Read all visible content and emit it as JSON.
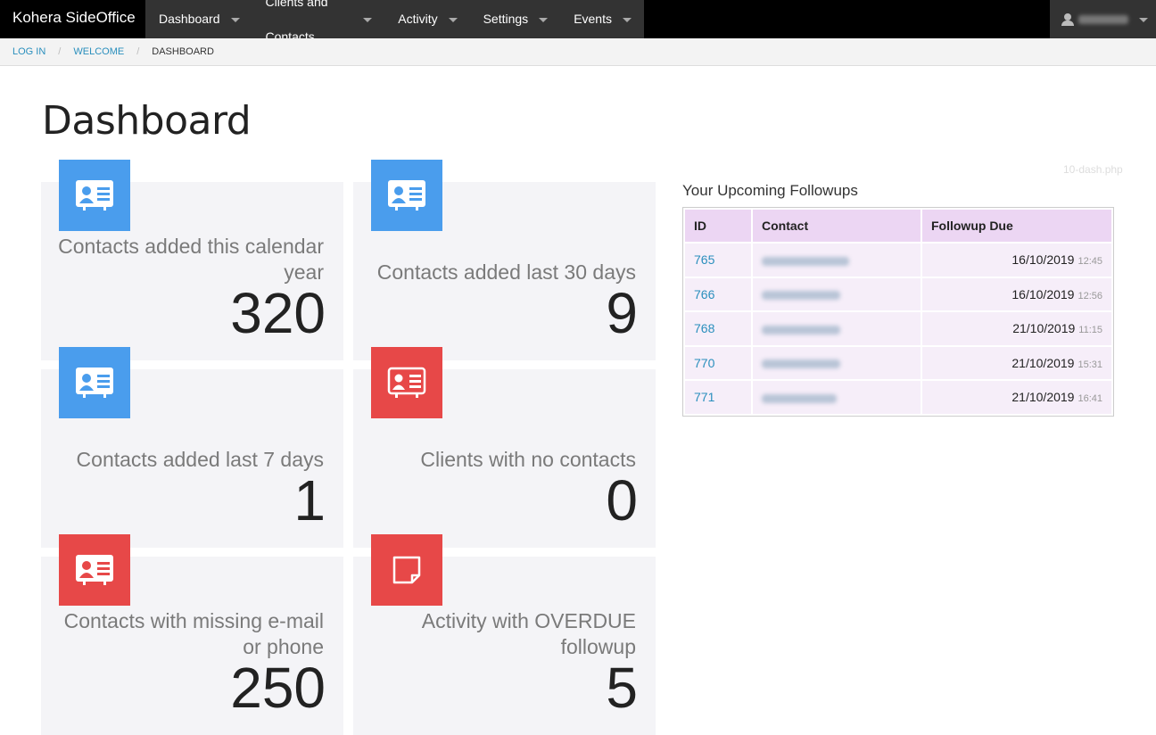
{
  "nav": {
    "brand": "Kohera SideOffice",
    "menu": [
      {
        "label": "Dashboard"
      },
      {
        "label": "Clients and Contacts"
      },
      {
        "label": "Activity"
      },
      {
        "label": "Settings"
      },
      {
        "label": "Events"
      }
    ],
    "user_icon": "user-icon"
  },
  "breadcrumb": {
    "items": [
      "LOG IN",
      "WELCOME"
    ],
    "current": "DASHBOARD",
    "separator": "/"
  },
  "page": {
    "title": "Dashboard",
    "file_tag": "10-dash.php"
  },
  "cards": [
    {
      "label": "Contacts added this calendar year",
      "value": "320",
      "color": "#4a9ded",
      "icon": "contact-card-icon"
    },
    {
      "label": "Contacts added last 30 days",
      "value": "9",
      "color": "#4a9ded",
      "icon": "contact-card-icon"
    },
    {
      "label": "Contacts added last 7 days",
      "value": "1",
      "color": "#4a9ded",
      "icon": "contact-card-icon"
    },
    {
      "label": "Clients with no contacts",
      "value": "0",
      "color": "#e74848",
      "icon": "contact-card-icon"
    },
    {
      "label": "Contacts with missing e-mail or phone",
      "value": "250",
      "color": "#e74848",
      "icon": "contact-card-icon"
    },
    {
      "label": "Activity with OVERDUE followup",
      "value": "5",
      "color": "#e74848",
      "icon": "sticky-note-icon"
    }
  ],
  "followups": {
    "title": "Your Upcoming Followups",
    "headers": [
      "ID",
      "Contact",
      "Followup Due"
    ],
    "rows": [
      {
        "id": "765",
        "date": "16/10/2019",
        "time": "12:45"
      },
      {
        "id": "766",
        "date": "16/10/2019",
        "time": "12:56"
      },
      {
        "id": "768",
        "date": "21/10/2019",
        "time": "11:15"
      },
      {
        "id": "770",
        "date": "21/10/2019",
        "time": "15:31"
      },
      {
        "id": "771",
        "date": "21/10/2019",
        "time": "16:41"
      }
    ]
  }
}
